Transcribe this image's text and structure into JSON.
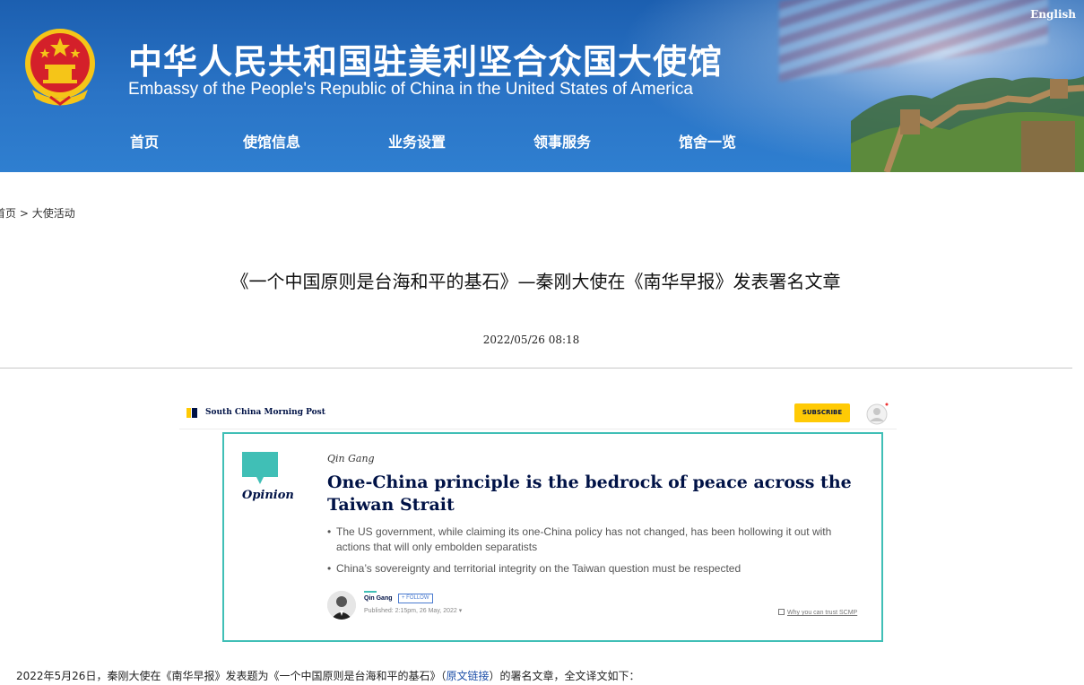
{
  "header": {
    "english_link": "English",
    "title_cn": "中华人民共和国驻美利坚合众国大使馆",
    "title_en": "Embassy of the People's Republic of China in the United States of America",
    "nav": [
      {
        "label": "首页"
      },
      {
        "label": "使馆信息"
      },
      {
        "label": "业务设置"
      },
      {
        "label": "领事服务"
      },
      {
        "label": "馆舍一览"
      }
    ],
    "colors": {
      "banner": "#2a74c6",
      "text": "#ffffff",
      "emblem_red": "#d4202a",
      "emblem_gold": "#f5c518"
    }
  },
  "breadcrumb": {
    "home": "首页",
    "separator": " > ",
    "current": "大使活动"
  },
  "article": {
    "title": "《一个中国原则是台海和平的基石》—秦刚大使在《南华早报》发表署名文章",
    "date": "2022/05/26 08:18"
  },
  "scmp": {
    "logo_text": "South China Morning Post",
    "subscribe": "SUBSCRIBE",
    "opinion_label": "Opinion",
    "author_top": "Qin Gang",
    "headline": "One-China principle is the bedrock of peace across the Taiwan Strait",
    "bullets": [
      "The US government, while claiming its one-China policy has not changed, has been hollowing it out with actions that will only embolden separatists",
      "China’s sovereignty and territorial integrity on the Taiwan question must be respected"
    ],
    "bullet_mark": "•",
    "author_name": "Qin Gang",
    "follow": "+ FOLLOW",
    "published": "Published: 2:15pm, 26 May, 2022 ▾",
    "trust_link": "Why you can trust SCMP",
    "colors": {
      "accent": "#40bfb6",
      "navy": "#001246",
      "yellow": "#ffca05"
    }
  },
  "body": {
    "before_link": "2022年5月26日，秦刚大使在《南华早报》发表题为《一个中国原则是台海和平的基石》（",
    "link": "原文链接",
    "after_link": "）的署名文章，全文译文如下："
  }
}
